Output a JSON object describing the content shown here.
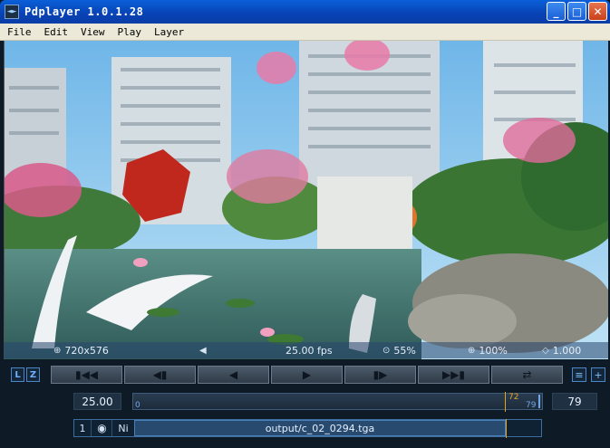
{
  "window": {
    "title": "Pdplayer 1.0.1.28",
    "icon": "app-icon",
    "controls": {
      "minimize": "_",
      "maximize": "□",
      "close": "✕"
    }
  },
  "menu": [
    "File",
    "Edit",
    "View",
    "Play",
    "Layer"
  ],
  "info_bar": {
    "resolution": "720x576",
    "fps": "25.00 fps",
    "zoom_view": "55%",
    "zoom_percent": "100%",
    "ratio": "1.000"
  },
  "transport": {
    "toggle_buttons": [
      "L",
      "Z"
    ],
    "icons": [
      "go-to-start-icon",
      "step-back-icon",
      "play-backward-icon",
      "play-forward-icon",
      "step-forward-icon",
      "go-to-end-icon",
      "loop-icon"
    ],
    "right_icons": [
      "list-icon",
      "add-icon"
    ]
  },
  "timeline": {
    "fps_value": "25.00",
    "start_frame": "0",
    "current_frame": "72",
    "end_frame_inner": "79",
    "end_frame": "79"
  },
  "layer": {
    "number": "1",
    "ni_label": "Ni",
    "file": "output/c_02_0294.tga"
  }
}
